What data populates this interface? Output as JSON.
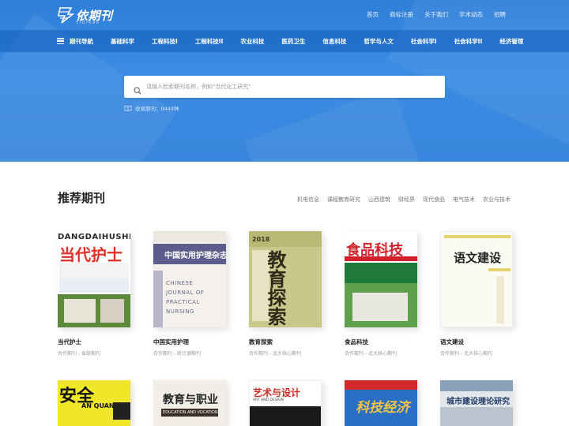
{
  "brand": {
    "name": "依期刊",
    "tagline": "Y i  Q i  K a n"
  },
  "top_links": [
    "首页",
    "商标注册",
    "关于我们",
    "学术动态",
    "招聘"
  ],
  "nav": {
    "guide": "期刊导航",
    "items": [
      "基础科学",
      "工程科技I",
      "工程科技II",
      "农业科技",
      "医药卫生",
      "信息科技",
      "哲学与人文",
      "社会科学I",
      "社会科学II",
      "经济管理"
    ]
  },
  "search": {
    "placeholder": "请输入检索期刊名称，例如\"当代化工研究\""
  },
  "collected": {
    "label": "收录期刊：",
    "count": "9449种"
  },
  "recommend": {
    "title": "推荐期刊",
    "tags": [
      "机电信息",
      "课程教育研究",
      "山西建筑",
      "财经界",
      "现代食品",
      "电气技术",
      "农业与技术"
    ],
    "journals": [
      {
        "name": "当代护士",
        "meta": "合作期刊 - 省级期刊",
        "cover_title": "当代护士",
        "cover_en": "DANGDAIHUSHI"
      },
      {
        "name": "中国实用护理",
        "meta": "合作期刊 - 统计源期刊",
        "cover_title": "中国实用护理杂志",
        "cover_en": "CHINESE JOURNAL OF PRACTICAL NURSING"
      },
      {
        "name": "教育探索",
        "meta": "合作期刊 - 北大核心期刊",
        "cover_title": "教育探索"
      },
      {
        "name": "食品科技",
        "meta": "合作期刊 - 北大核心期刊",
        "cover_title": "食品科技"
      },
      {
        "name": "语文建设",
        "meta": "合作期刊 - 北大核心期刊",
        "cover_title": "语文建设"
      }
    ],
    "more_covers": [
      {
        "cover_title": "安全",
        "cover_en": "AN QUAN"
      },
      {
        "cover_title": "教育与职业",
        "cover_en": "EDUCATION AND VOCATION"
      },
      {
        "cover_title": "艺术与设计",
        "cover_en": "ART AND DESIGN"
      },
      {
        "cover_title": "科技经济"
      },
      {
        "cover_title": "城市建设理论研究"
      }
    ]
  },
  "colors": {
    "hero": "#3a86dd",
    "nav": "#1f68c4",
    "accent": "#2f7fd8"
  }
}
